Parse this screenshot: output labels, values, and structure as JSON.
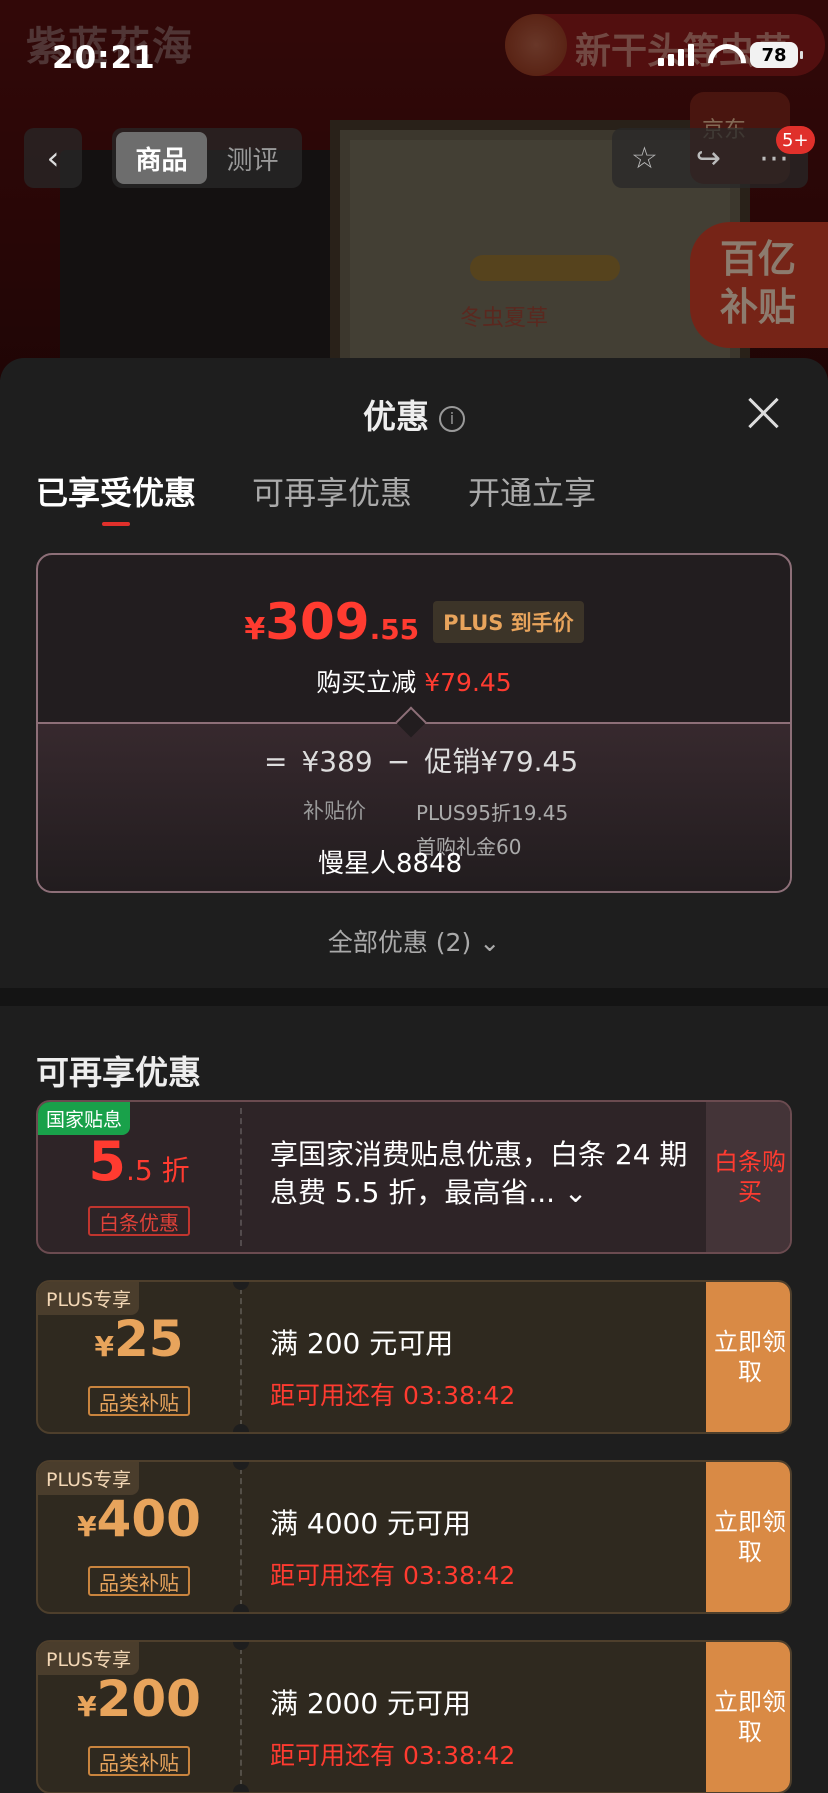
{
  "status_bar": {
    "time": "20:21",
    "battery": "78"
  },
  "hero": {
    "brand_text": "紫蓝花海",
    "banner_text": "新干头等虫草",
    "box_label": "冬虫夏草",
    "jd_badge": "京东",
    "subsidy_badge": [
      "百亿",
      "补贴"
    ],
    "cart_count": "5+"
  },
  "nav": {
    "back_icon": "chevron-left-icon",
    "tabs": [
      {
        "label": "商品",
        "active": true
      },
      {
        "label": "测评",
        "active": false
      }
    ],
    "actions": [
      "star-icon",
      "share-icon",
      "more-icon"
    ]
  },
  "sheet": {
    "title": "优惠",
    "tabs": [
      "已享受优惠",
      "可再享优惠",
      "开通立享"
    ],
    "price": {
      "yen": "¥",
      "integer": "309",
      "decimal": ".55",
      "tag": "PLUS 到手价",
      "reduce_label": "购买立减",
      "reduce_value": "¥79.45",
      "equals": "=",
      "base": "¥389",
      "minus": "−",
      "promo": "促销¥79.45",
      "base_label": "补贴价",
      "promo_detail_1": "PLUS95折19.45",
      "promo_detail_2": "首购礼金60",
      "user": "慢星人8848"
    },
    "all_offers": "全部优惠 (2)"
  },
  "extra": {
    "title": "可再享优惠",
    "gov": {
      "tag": "国家贴息",
      "amount_big": "5",
      "amount_small": ".5 折",
      "kind": "白条优惠",
      "desc": "享国家消费贴息优惠，白条 24 期息费 5.5 折，最高省... ⌄",
      "action": "白条购买"
    },
    "coupons": [
      {
        "tag": "PLUS专享",
        "amount": "25",
        "kind": "品类补贴",
        "condition": "满 200 元可用",
        "countdown": "距可用还有 03:38:42",
        "action": "立即领取"
      },
      {
        "tag": "PLUS专享",
        "amount": "400",
        "kind": "品类补贴",
        "condition": "满 4000 元可用",
        "countdown": "距可用还有 03:38:42",
        "action": "立即领取"
      },
      {
        "tag": "PLUS专享",
        "amount": "200",
        "kind": "品类补贴",
        "condition": "满 2000 元可用",
        "countdown": "距可用还有 03:38:42",
        "action": "立即领取"
      }
    ]
  },
  "colors": {
    "accent_red": "#ff3b30",
    "plus_gold": "#e8a45c",
    "gov_green": "#19a14a",
    "plus_action": "#d98a45"
  }
}
